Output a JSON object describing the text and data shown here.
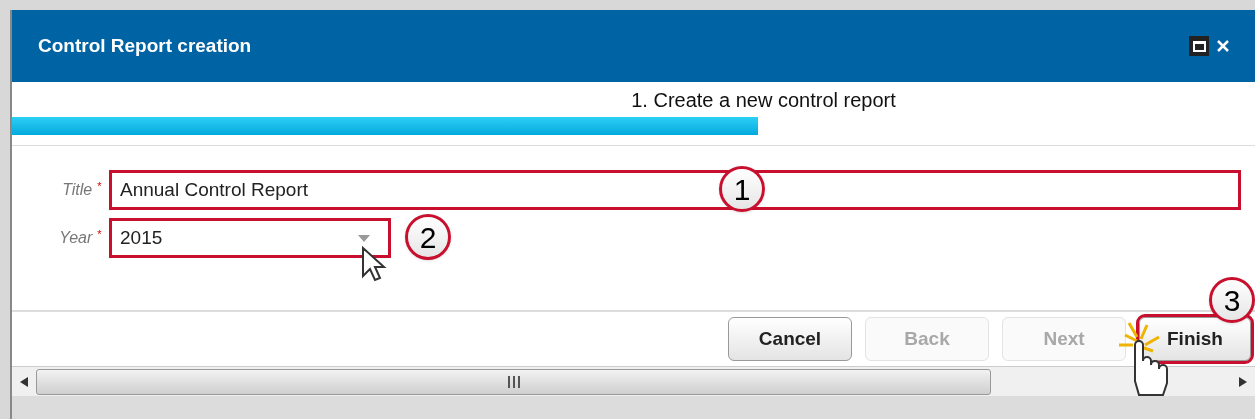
{
  "window": {
    "title": "Control Report creation"
  },
  "step": {
    "label": "1. Create a new control report",
    "level": 0.6
  },
  "fields": [
    {
      "kind": "text",
      "label": "Title",
      "required_mark": "*",
      "value": "Annual Control Report",
      "callout": "1"
    },
    {
      "kind": "select",
      "label": "Year",
      "required_mark": "*",
      "value": "2015",
      "callout": "2"
    }
  ],
  "buttons": [
    {
      "label": "Cancel",
      "disabled": false,
      "highlighted": false
    },
    {
      "label": "Back",
      "disabled": true,
      "highlighted": false
    },
    {
      "label": "Next",
      "disabled": true,
      "highlighted": false
    },
    {
      "label": "Finish",
      "disabled": false,
      "highlighted": true,
      "callout": "3"
    }
  ]
}
